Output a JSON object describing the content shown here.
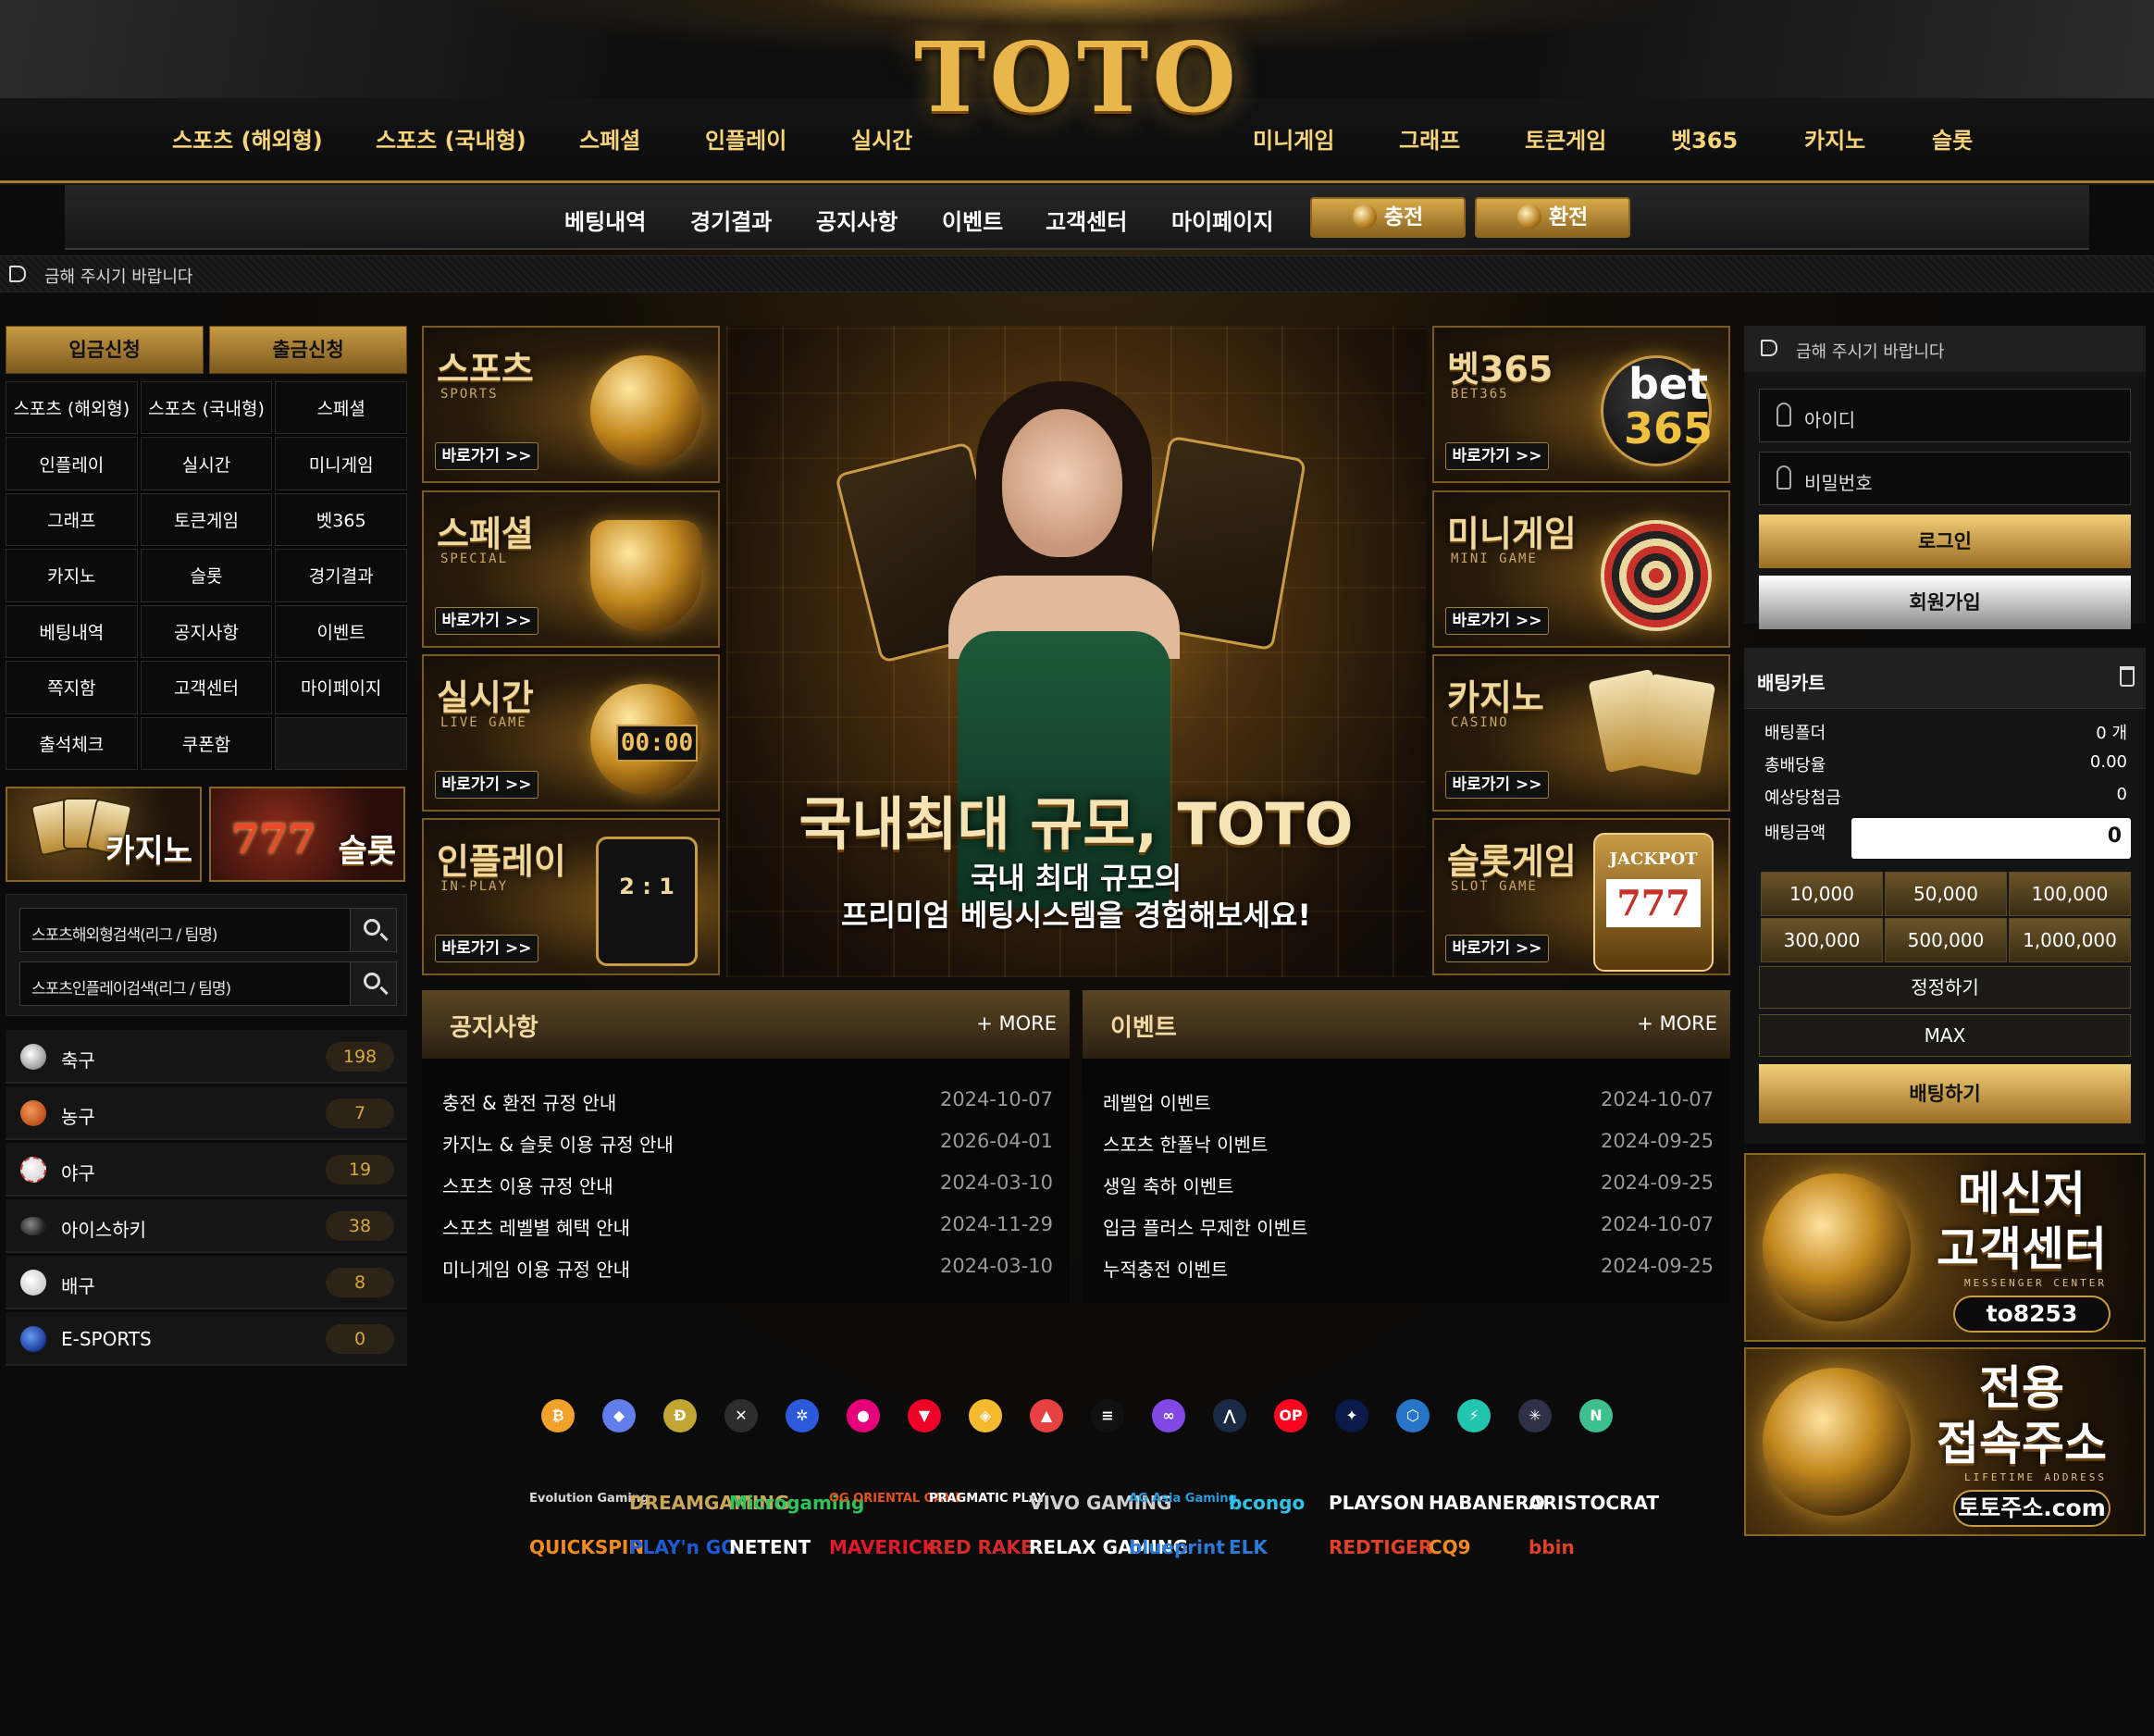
{
  "brand": {
    "logo": "TOTO"
  },
  "main_nav": [
    "스포츠 (해외형)",
    "스포츠 (국내형)",
    "스페셜",
    "인플레이",
    "실시간",
    "미니게임",
    "그래프",
    "토큰게임",
    "벳365",
    "카지노",
    "슬롯"
  ],
  "sub_nav": [
    "베팅내역",
    "경기결과",
    "공지사항",
    "이벤트",
    "고객센터",
    "마이페이지"
  ],
  "charge_label": "충전",
  "exchange_label": "환전",
  "ticker": "금해 주시기 바랍니다",
  "left": {
    "deposit_label": "입금신청",
    "withdraw_label": "출금신청",
    "menu": [
      "스포츠 (해외형)",
      "스포츠 (국내형)",
      "스페셜",
      "인플레이",
      "실시간",
      "미니게임",
      "그래프",
      "토큰게임",
      "벳365",
      "카지노",
      "슬롯",
      "경기결과",
      "베팅내역",
      "공지사항",
      "이벤트",
      "쪽지함",
      "고객센터",
      "마이페이지",
      "출석체크",
      "쿠폰함"
    ],
    "banners": [
      "카지노",
      "슬롯"
    ],
    "search": [
      "스포츠해외형검색(리그 / 팀명)",
      "스포츠인플레이검색(리그 / 팀명)"
    ],
    "sports": [
      {
        "name": "축구",
        "count": "198",
        "icon": "soccer-ball-icon",
        "color": "#e8e8e8"
      },
      {
        "name": "농구",
        "count": "7",
        "icon": "basketball-icon",
        "color": "#e06a2a"
      },
      {
        "name": "야구",
        "count": "19",
        "icon": "baseball-icon",
        "color": "#f2f2f2"
      },
      {
        "name": "아이스하키",
        "count": "38",
        "icon": "hockey-puck-icon",
        "color": "#555555"
      },
      {
        "name": "배구",
        "count": "8",
        "icon": "volleyball-icon",
        "color": "#dcdcdc"
      },
      {
        "name": "E-SPORTS",
        "count": "0",
        "icon": "esports-icon",
        "color": "#2a58c8"
      }
    ]
  },
  "tiles_left": [
    {
      "title": "스포츠",
      "sub": "SPORTS",
      "go": "바로가기 >>"
    },
    {
      "title": "스페셜",
      "sub": "SPECIAL",
      "go": "바로가기 >>"
    },
    {
      "title": "실시간",
      "sub": "LIVE GAME",
      "go": "바로가기 >>"
    },
    {
      "title": "인플레이",
      "sub": "IN-PLAY",
      "go": "바로가기 >>"
    }
  ],
  "tiles_right": [
    {
      "title": "벳365",
      "sub": "BET365",
      "go": "바로가기 >>"
    },
    {
      "title": "미니게임",
      "sub": "MINI GAME",
      "go": "바로가기 >>"
    },
    {
      "title": "카지노",
      "sub": "CASINO",
      "go": "바로가기 >>"
    },
    {
      "title": "슬롯게임",
      "sub": "SLOT GAME",
      "go": "바로가기 >>"
    }
  ],
  "tile_art": {
    "bet365_line1": "bet",
    "bet365_line2": "365",
    "live_clock": "00:00",
    "inplay_score": "2 : 1",
    "jackpot": "JACKPOT"
  },
  "hero": {
    "title": "국내최대 규모, TOTO",
    "line1": "국내 최대 규모의",
    "line2": "프리미엄 베팅시스템을 경험해보세요!"
  },
  "notice": {
    "title": "공지사항",
    "more": "+ MORE",
    "items": [
      {
        "t": "충전 & 환전 규정 안내",
        "d": "2024-10-07"
      },
      {
        "t": "카지노 & 슬롯 이용 규정 안내",
        "d": "2026-04-01"
      },
      {
        "t": "스포츠 이용 규정 안내",
        "d": "2024-03-10"
      },
      {
        "t": "스포츠 레벨별 혜택 안내",
        "d": "2024-11-29"
      },
      {
        "t": "미니게임 이용 규정 안내",
        "d": "2024-03-10"
      }
    ]
  },
  "event": {
    "title": "이벤트",
    "more": "+ MORE",
    "items": [
      {
        "t": "레벨업 이벤트",
        "d": "2024-10-07"
      },
      {
        "t": "스포츠 한폴낙 이벤트",
        "d": "2024-09-25"
      },
      {
        "t": "생일 축하 이벤트",
        "d": "2024-09-25"
      },
      {
        "t": "입금 플러스 무제한 이벤트",
        "d": "2024-10-07"
      },
      {
        "t": "누적충전 이벤트",
        "d": "2024-09-25"
      }
    ]
  },
  "login": {
    "ticker": "금해 주시기 바랍니다",
    "id_placeholder": "아이디",
    "pw_placeholder": "비밀번호",
    "login_label": "로그인",
    "signup_label": "회원가입"
  },
  "betcart": {
    "title": "배팅카트",
    "rows": [
      {
        "k": "배팅폴더",
        "v": "0 개"
      },
      {
        "k": "총배당율",
        "v": "0.00"
      },
      {
        "k": "예상당첨금",
        "v": "0"
      }
    ],
    "amount_label": "배팅금액",
    "amount_value": "0",
    "amounts": [
      "10,000",
      "50,000",
      "100,000",
      "300,000",
      "500,000",
      "1,000,000"
    ],
    "reset_label": "정정하기",
    "max_label": "MAX",
    "bet_label": "배팅하기"
  },
  "right_banners": [
    {
      "l1": "메신저",
      "l2": "고객센터",
      "small": "MESSENGER CENTER",
      "pill": "to8253"
    },
    {
      "l1": "전용",
      "l2": "접속주소",
      "small": "LIFETIME ADDRESS",
      "pill": "토토주소.com"
    }
  ],
  "crypto": [
    {
      "s": "₿",
      "c": "#f2a12a"
    },
    {
      "s": "◆",
      "c": "#627eea"
    },
    {
      "s": "Ð",
      "c": "#c2a633"
    },
    {
      "s": "✕",
      "c": "#2e2e2e"
    },
    {
      "s": "✲",
      "c": "#2a5ada"
    },
    {
      "s": "●",
      "c": "#e6007a"
    },
    {
      "s": "▼",
      "c": "#ef0027"
    },
    {
      "s": "◈",
      "c": "#f3ba2f"
    },
    {
      "s": "▲",
      "c": "#e84142"
    },
    {
      "s": "≡",
      "c": "#111111"
    },
    {
      "s": "∞",
      "c": "#8247e5"
    },
    {
      "s": "⋀",
      "c": "#1b2a44"
    },
    {
      "s": "OP",
      "c": "#ff0420"
    },
    {
      "s": "✦",
      "c": "#0a1b4a"
    },
    {
      "s": "⬡",
      "c": "#2775ca"
    },
    {
      "s": "⚡",
      "c": "#23c4b0"
    },
    {
      "s": "✳",
      "c": "#2e3148"
    },
    {
      "s": "N",
      "c": "#3ec08c"
    }
  ],
  "providers_row1": [
    {
      "n": "Evolution Gaming",
      "c": "#d8d8d8"
    },
    {
      "n": "DREAMGAMING",
      "c": "#c9a65a"
    },
    {
      "n": "Microgaming",
      "c": "#2ec25a"
    },
    {
      "n": "OG ORIENTAL GAME",
      "c": "#e0531f"
    },
    {
      "n": "PRAGMATIC PLAY",
      "c": "#ffffff"
    },
    {
      "n": "VIVO GAMING",
      "c": "#cfcfcf"
    },
    {
      "n": "AG Asia Gaming",
      "c": "#2a9ad8"
    },
    {
      "n": "bcongo",
      "c": "#2ec4e8"
    },
    {
      "n": "PLAYSON",
      "c": "#ffffff"
    },
    {
      "n": "HABANERO",
      "c": "#ffffff"
    },
    {
      "n": "ARISTOCRAT",
      "c": "#ffffff"
    }
  ],
  "providers_row2": [
    {
      "n": "QUICKSPIN",
      "c": "#f28a1e"
    },
    {
      "n": "PLAY'n GO",
      "c": "#1f5bd4"
    },
    {
      "n": "NETENT",
      "c": "#ffffff"
    },
    {
      "n": "MAVERICK",
      "c": "#e01a2a"
    },
    {
      "n": "RED RAKE",
      "c": "#d42a2a"
    },
    {
      "n": "RELAX GAMING",
      "c": "#ffffff"
    },
    {
      "n": "blueprint",
      "c": "#2a7ad8"
    },
    {
      "n": "ELK",
      "c": "#2a7ad8"
    },
    {
      "n": "REDTIGER",
      "c": "#e0412a"
    },
    {
      "n": "CQ9",
      "c": "#f28a1e"
    },
    {
      "n": "bbin",
      "c": "#e0412a"
    }
  ]
}
